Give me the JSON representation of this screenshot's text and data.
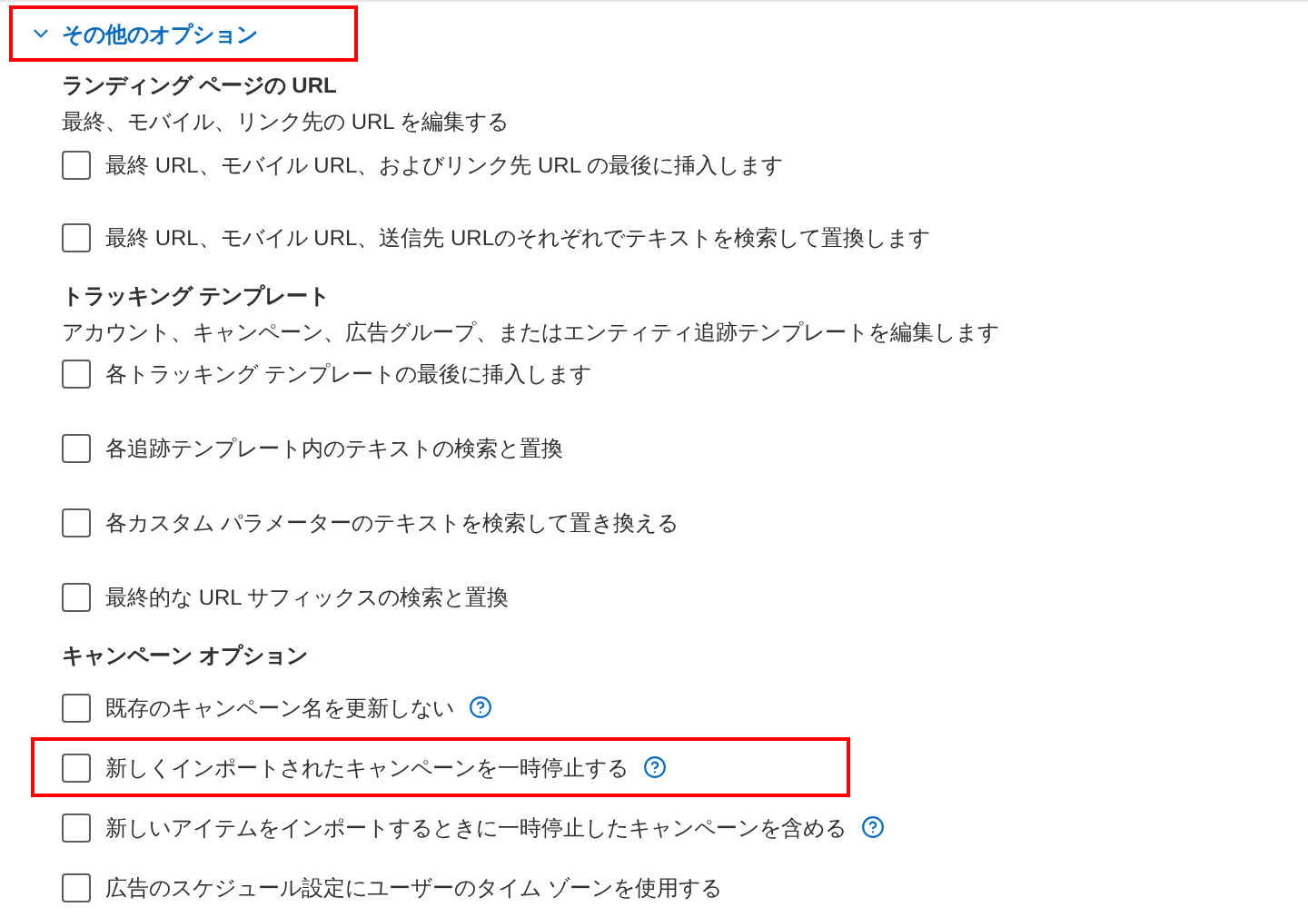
{
  "header": {
    "label": "その他のオプション",
    "expanded": true,
    "highlighted": true
  },
  "sections": [
    {
      "title": "ランディング ページの URL",
      "description": "最終、モバイル、リンク先の URL を編集する",
      "options": [
        {
          "label": "最終 URL、モバイル URL、およびリンク先 URL の最後に挿入します",
          "checked": false,
          "help": false,
          "highlighted": false
        },
        {
          "label": "最終 URL、モバイル URL、送信先 URLのそれぞれでテキストを検索して置換します",
          "checked": false,
          "help": false,
          "highlighted": false
        }
      ]
    },
    {
      "title": "トラッキング テンプレート",
      "description": "アカウント、キャンペーン、広告グループ、またはエンティティ追跡テンプレートを編集します",
      "options": [
        {
          "label": "各トラッキング テンプレートの最後に挿入します",
          "checked": false,
          "help": false,
          "highlighted": false
        },
        {
          "label": "各追跡テンプレート内のテキストの検索と置換",
          "checked": false,
          "help": false,
          "highlighted": false
        },
        {
          "label": "各カスタム パラメーターのテキストを検索して置き換える",
          "checked": false,
          "help": false,
          "highlighted": false
        },
        {
          "label": "最終的な URL サフィックスの検索と置換",
          "checked": false,
          "help": false,
          "highlighted": false
        }
      ]
    },
    {
      "title": "キャンペーン オプション",
      "options": [
        {
          "label": "既存のキャンペーン名を更新しない",
          "checked": false,
          "help": true,
          "highlighted": false
        },
        {
          "label": "新しくインポートされたキャンペーンを一時停止する",
          "checked": false,
          "help": true,
          "highlighted": true
        },
        {
          "label": "新しいアイテムをインポートするときに一時停止したキャンペーンを含める",
          "checked": false,
          "help": true,
          "highlighted": false
        },
        {
          "label": "広告のスケジュール設定にユーザーのタイム ゾーンを使用する",
          "checked": false,
          "help": false,
          "highlighted": false
        }
      ]
    }
  ]
}
